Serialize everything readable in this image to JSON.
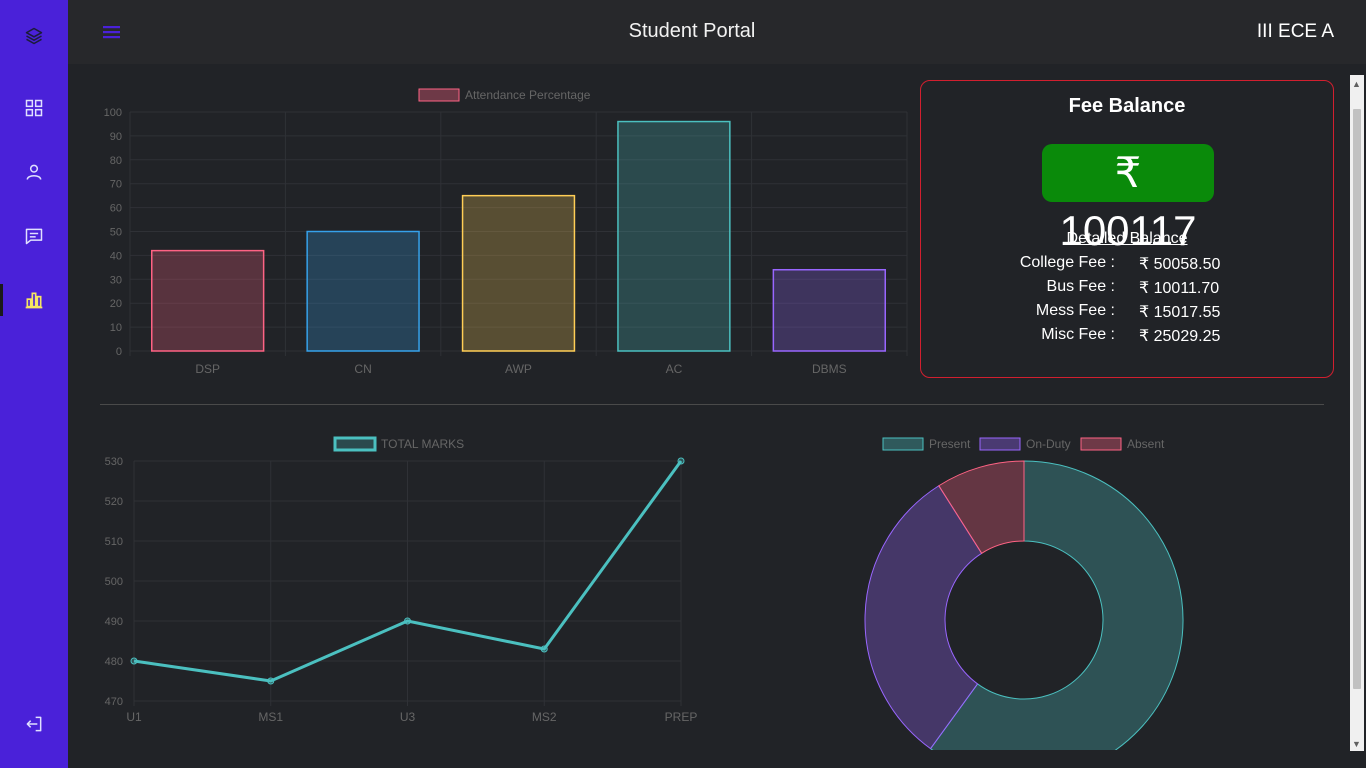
{
  "app": {
    "title": "Student Portal",
    "class_label": "III ECE A"
  },
  "sidebar": {
    "items": [
      {
        "icon": "layers-icon"
      },
      {
        "icon": "dashboard-grid-icon"
      },
      {
        "icon": "user-icon"
      },
      {
        "icon": "message-icon"
      },
      {
        "icon": "bar-chart-icon",
        "active": true
      },
      {
        "icon": "logout-icon"
      }
    ]
  },
  "fee": {
    "title": "Fee Balance",
    "total": "₹ 100117",
    "detail_title": "Detailed Balance",
    "rows": [
      {
        "label": "College Fee :",
        "value": "₹ 50058.50"
      },
      {
        "label": "Bus Fee :",
        "value": "₹ 10011.70"
      },
      {
        "label": "Mess Fee :",
        "value": "₹ 15017.55"
      },
      {
        "label": "Misc Fee :",
        "value": "₹ 25029.25"
      }
    ]
  },
  "chart_data": [
    {
      "type": "bar",
      "legend": "Attendance Percentage",
      "categories": [
        "DSP",
        "CN",
        "AWP",
        "AC",
        "DBMS"
      ],
      "values": [
        42,
        50,
        65,
        96,
        34
      ],
      "ylim": [
        0,
        100
      ],
      "yticks": [
        0,
        10,
        20,
        30,
        40,
        50,
        60,
        70,
        80,
        90,
        100
      ],
      "colors": [
        "#ff6384",
        "#36a2eb",
        "#ffce56",
        "#4bc0c0",
        "#9966ff"
      ]
    },
    {
      "type": "line",
      "legend": "TOTAL MARKS",
      "categories": [
        "U1",
        "MS1",
        "U3",
        "MS2",
        "PREP"
      ],
      "values": [
        480,
        475,
        490,
        483,
        530
      ],
      "ylim": [
        470,
        530
      ],
      "yticks": [
        470,
        480,
        490,
        500,
        510,
        520,
        530
      ],
      "color": "#4bc0c0"
    },
    {
      "type": "pie",
      "legend": [
        "Present",
        "On-Duty",
        "Absent"
      ],
      "values": [
        60,
        31,
        9
      ],
      "colors": [
        "#4bc0c0",
        "#9966ff",
        "#ff6384"
      ]
    }
  ]
}
